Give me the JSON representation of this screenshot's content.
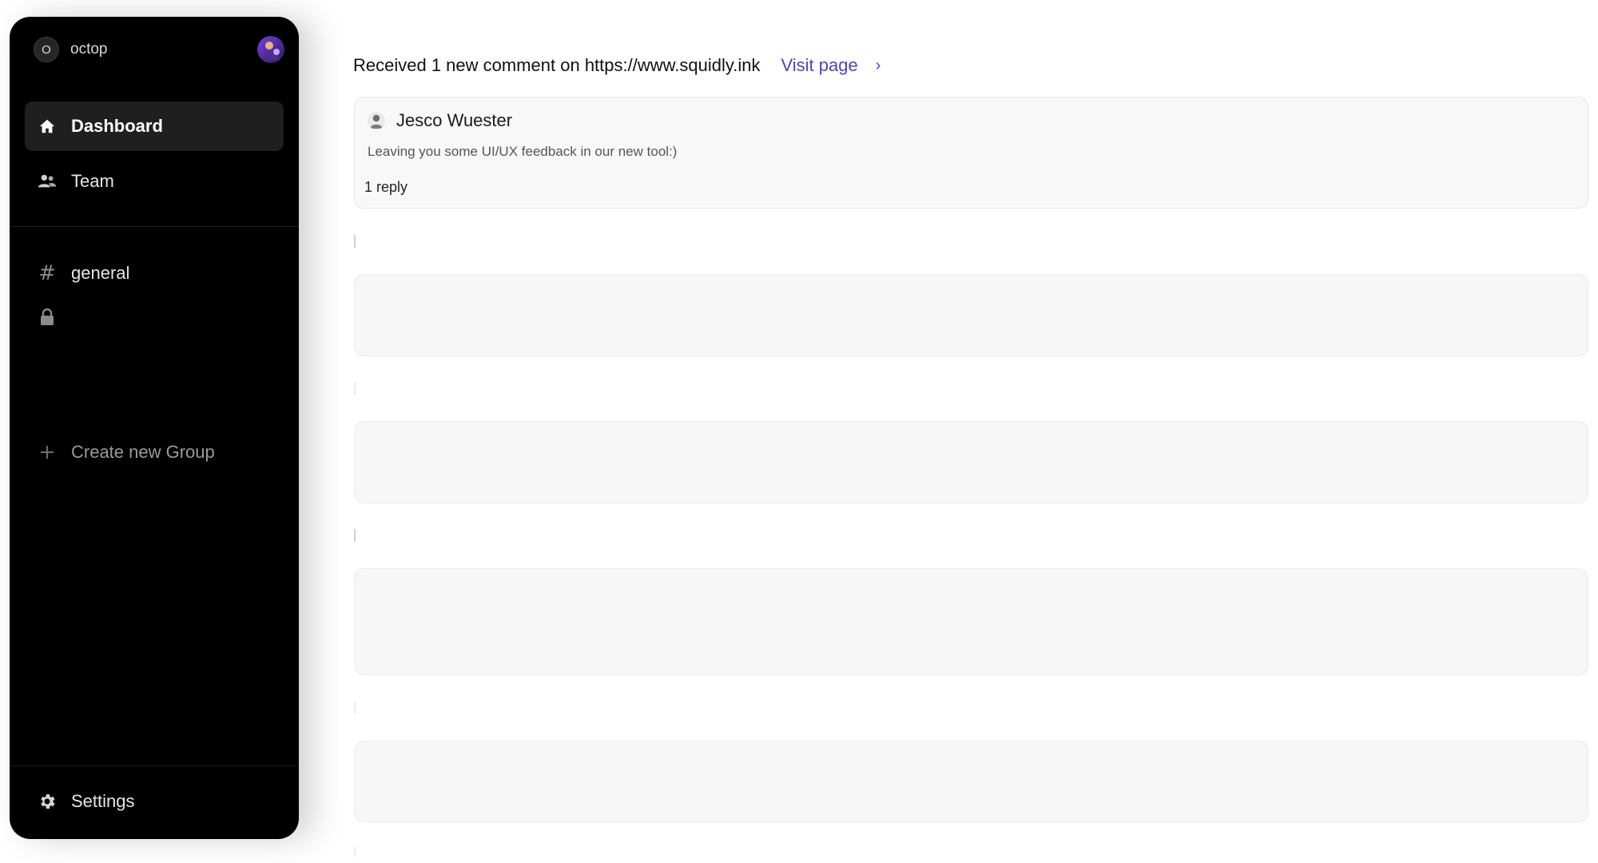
{
  "workspace": {
    "initial": "O",
    "name": "octop"
  },
  "sidebar": {
    "items": [
      {
        "label": "Dashboard",
        "icon": "home-icon",
        "active": true
      },
      {
        "label": "Team",
        "icon": "users-icon",
        "active": false
      }
    ],
    "channels": [
      {
        "label": "general",
        "icon": "hash-icon"
      },
      {
        "label": "",
        "icon": "lock-icon"
      }
    ],
    "create_group_label": "Create new Group",
    "settings_label": "Settings"
  },
  "main": {
    "notice_text": "Received 1 new comment on https://www.squidly.ink",
    "visit_link_label": "Visit page",
    "comment": {
      "author": "Jesco Wuester",
      "body": "Leaving you some UI/UX feedback in our new tool:)",
      "replies": "1 reply"
    }
  },
  "colors": {
    "sidebar_bg": "#000000",
    "active_item_bg": "#1f1f1f",
    "link": "#4a44c8",
    "card_bg": "#f8f8f8"
  }
}
